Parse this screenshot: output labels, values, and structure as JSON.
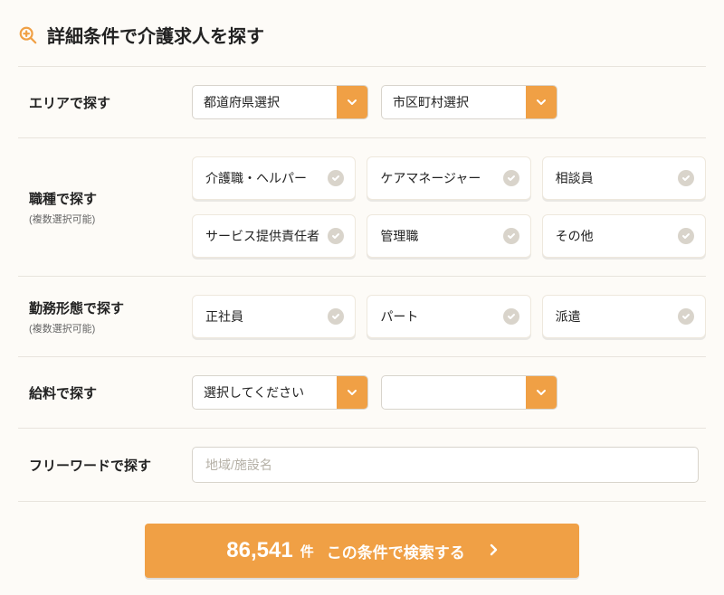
{
  "title": "詳細条件で介護求人を探す",
  "rows": {
    "area": {
      "label": "エリアで探す",
      "selects": [
        "都道府県選択",
        "市区町村選択"
      ]
    },
    "job": {
      "label": "職種で探す",
      "sub": "(複数選択可能)",
      "options": [
        "介護職・ヘルパー",
        "ケアマネージャー",
        "相談員",
        "サービス提供責任者",
        "管理職",
        "その他"
      ]
    },
    "employment": {
      "label": "勤務形態で探す",
      "sub": "(複数選択可能)",
      "options": [
        "正社員",
        "パート",
        "派遣"
      ]
    },
    "salary": {
      "label": "給料で探す",
      "selects": [
        "選択してください",
        ""
      ]
    },
    "freeword": {
      "label": "フリーワードで探す",
      "placeholder": "地域/施設名"
    }
  },
  "submit": {
    "count": "86,541",
    "unit": "件",
    "label": "この条件で検索する"
  }
}
